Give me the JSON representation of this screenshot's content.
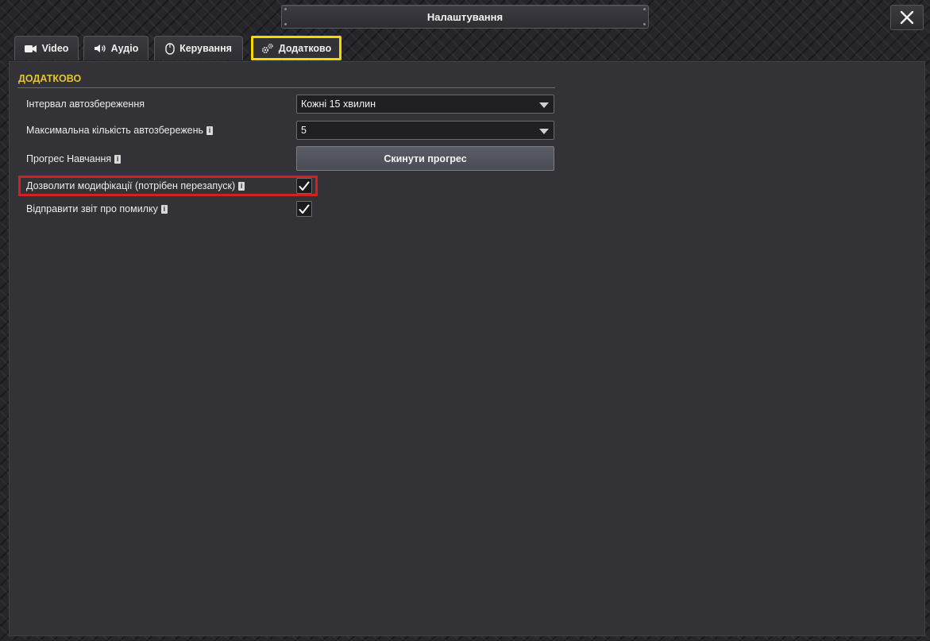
{
  "window": {
    "title": "Налаштування"
  },
  "tabs": [
    {
      "label": "Video",
      "icon": "video-camera-icon"
    },
    {
      "label": "Аудіо",
      "icon": "speaker-icon"
    },
    {
      "label": "Керування",
      "icon": "mouse-icon"
    },
    {
      "label": "Додатково",
      "icon": "gears-icon",
      "active": true
    }
  ],
  "section": {
    "title": "ДОДАТКОВО"
  },
  "settings": {
    "autosave_interval": {
      "label": "Інтервал автозбереження",
      "value": "Кожні 15 хвилин"
    },
    "max_autosaves": {
      "label": "Максимальна кількість автозбережень",
      "value": "5"
    },
    "tutorial_progress": {
      "label": "Прогрес Навчання",
      "button": "Скинути прогрес"
    },
    "allow_mods": {
      "label": "Дозволити модифікації (потрібен перезапуск)",
      "checked": true
    },
    "send_bug_report": {
      "label": "Відправити звіт про помилку",
      "checked": true
    }
  },
  "colors": {
    "accent": "#e8c232",
    "tab_highlight": "#f5d800",
    "annotation": "#d42020"
  }
}
